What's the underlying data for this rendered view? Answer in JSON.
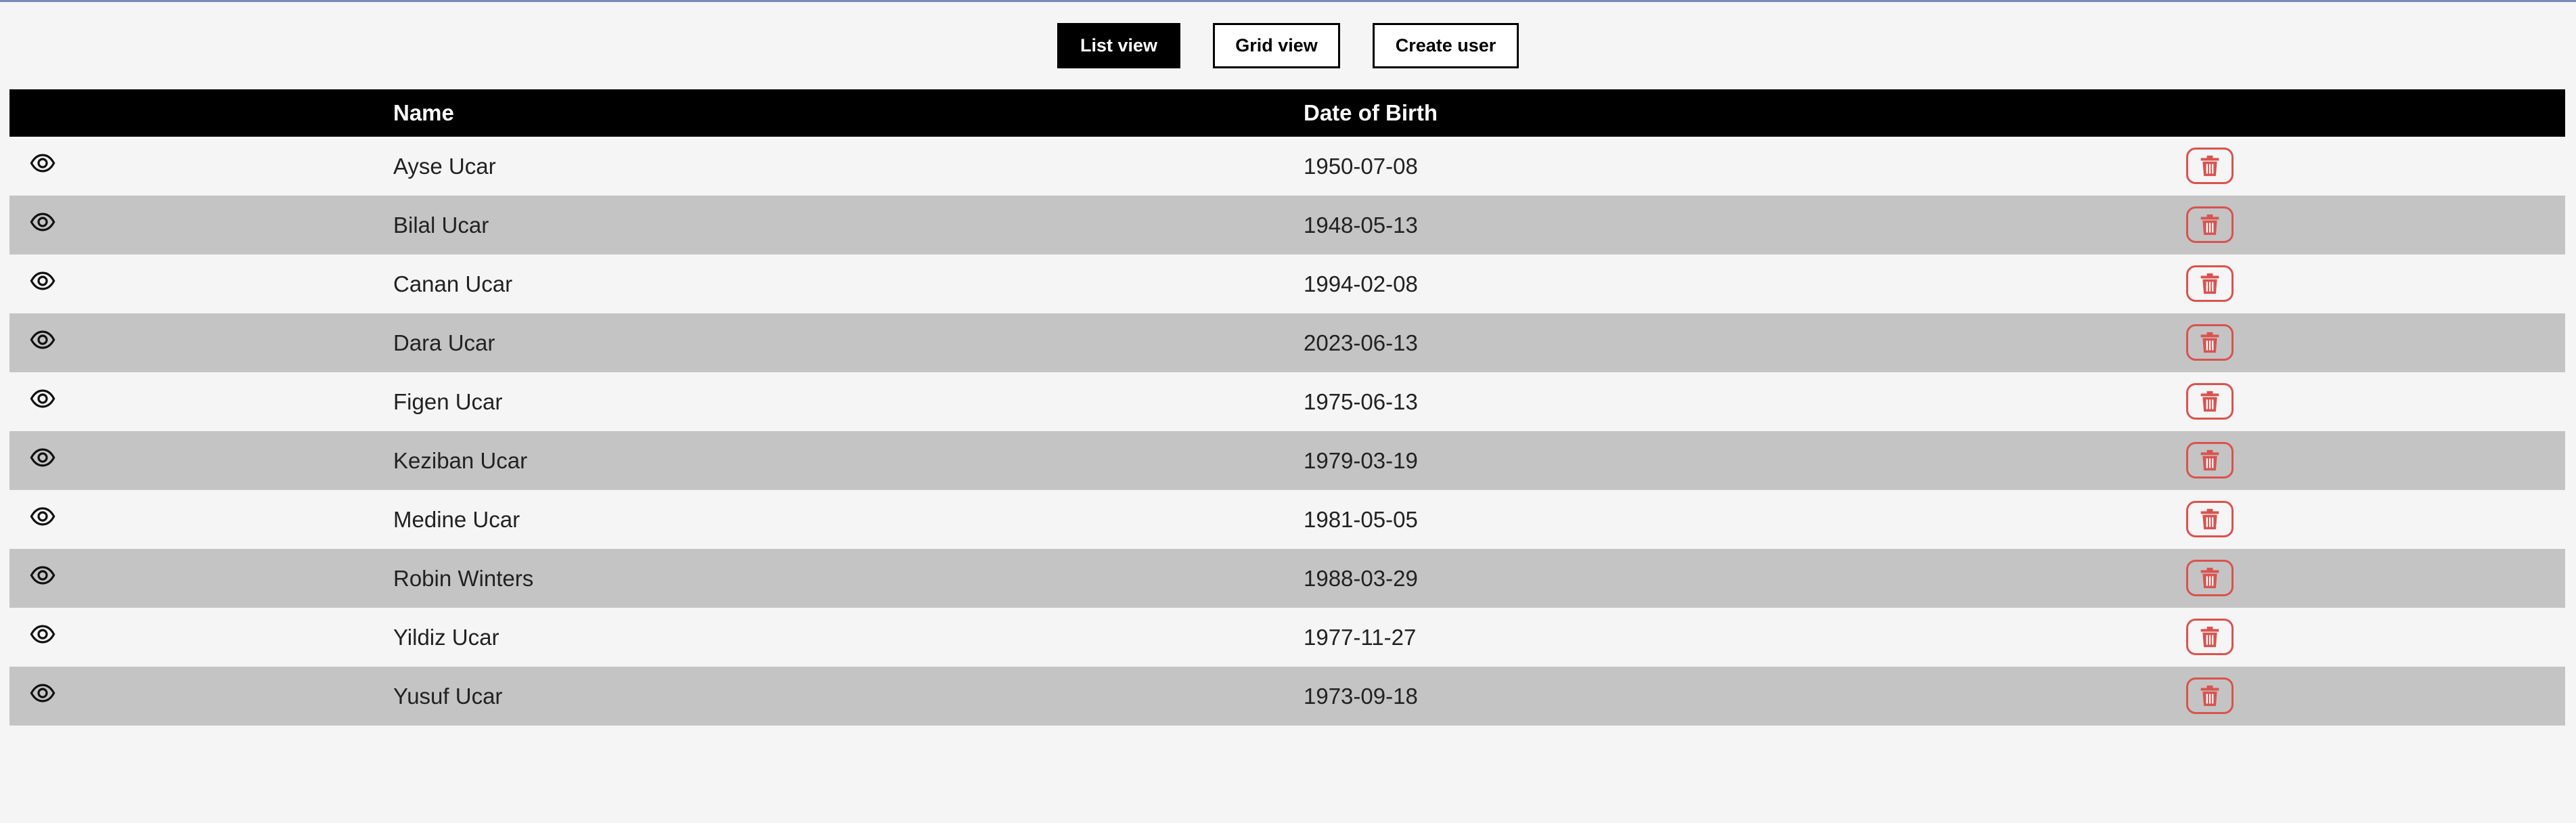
{
  "toolbar": {
    "list_view_label": "List view",
    "grid_view_label": "Grid view",
    "create_user_label": "Create user"
  },
  "table": {
    "columns": {
      "name": "Name",
      "dob": "Date of Birth"
    },
    "rows": [
      {
        "name": "Ayse Ucar",
        "dob": "1950-07-08"
      },
      {
        "name": "Bilal Ucar",
        "dob": "1948-05-13"
      },
      {
        "name": "Canan Ucar",
        "dob": "1994-02-08"
      },
      {
        "name": "Dara Ucar",
        "dob": "2023-06-13"
      },
      {
        "name": "Figen Ucar",
        "dob": "1975-06-13"
      },
      {
        "name": "Keziban Ucar",
        "dob": "1979-03-19"
      },
      {
        "name": "Medine Ucar",
        "dob": "1981-05-05"
      },
      {
        "name": "Robin Winters",
        "dob": "1988-03-29"
      },
      {
        "name": "Yildiz Ucar",
        "dob": "1977-11-27"
      },
      {
        "name": "Yusuf Ucar",
        "dob": "1973-09-18"
      }
    ],
    "row_icons": {
      "view": "eye-icon",
      "delete": "trash-icon"
    }
  },
  "colors": {
    "header_bg": "#000000",
    "row_alt_bg": "#c4c4c4",
    "page_bg": "#f5f5f5",
    "delete_red": "#d9534f"
  }
}
